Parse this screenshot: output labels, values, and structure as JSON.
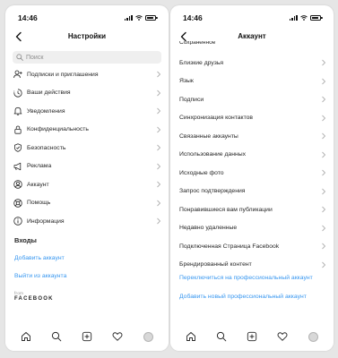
{
  "status_bar": {
    "time": "14:46"
  },
  "left_screen": {
    "title": "Настройки",
    "search_placeholder": "Поиск",
    "items": [
      {
        "label": "Подписки и приглашения",
        "icon": "person-plus-icon"
      },
      {
        "label": "Ваши действия",
        "icon": "activity-clock-icon"
      },
      {
        "label": "Уведомления",
        "icon": "bell-icon"
      },
      {
        "label": "Конфиденциальность",
        "icon": "lock-icon"
      },
      {
        "label": "Безопасность",
        "icon": "shield-icon"
      },
      {
        "label": "Реклама",
        "icon": "megaphone-icon"
      },
      {
        "label": "Аккаунт",
        "icon": "account-circle-icon"
      },
      {
        "label": "Помощь",
        "icon": "lifebuoy-icon"
      },
      {
        "label": "Информация",
        "icon": "info-icon"
      }
    ],
    "logins_heading": "Входы",
    "add_account": "Добавить аккаунт",
    "logout": "Выйти из аккаунта",
    "from_label": "from",
    "brand": "FACEBOOK"
  },
  "right_screen": {
    "title": "Аккаунт",
    "cutoff_text": "Сохранённое",
    "items": [
      {
        "label": "Близкие друзья"
      },
      {
        "label": "Язык"
      },
      {
        "label": "Подписи"
      },
      {
        "label": "Синхронизация контактов"
      },
      {
        "label": "Связанные аккаунты"
      },
      {
        "label": "Использование данных"
      },
      {
        "label": "Исходные фото"
      },
      {
        "label": "Запрос подтверждения"
      },
      {
        "label": "Понравившиеся вам публикации"
      },
      {
        "label": "Недавно удаленные"
      },
      {
        "label": "Подключенная Страница Facebook"
      },
      {
        "label": "Брендированный контент"
      }
    ],
    "switch_professional": "Переключиться на профессиональный аккаунт",
    "add_professional": "Добавить новый профессиональный аккаунт"
  },
  "tab_bar": [
    "home-icon",
    "search-icon",
    "new-post-icon",
    "heart-icon",
    "profile-avatar"
  ],
  "colors": {
    "link": "#3897f0",
    "text": "#262626",
    "secondary": "#8e8e8e",
    "background": "#e6e6e6"
  }
}
